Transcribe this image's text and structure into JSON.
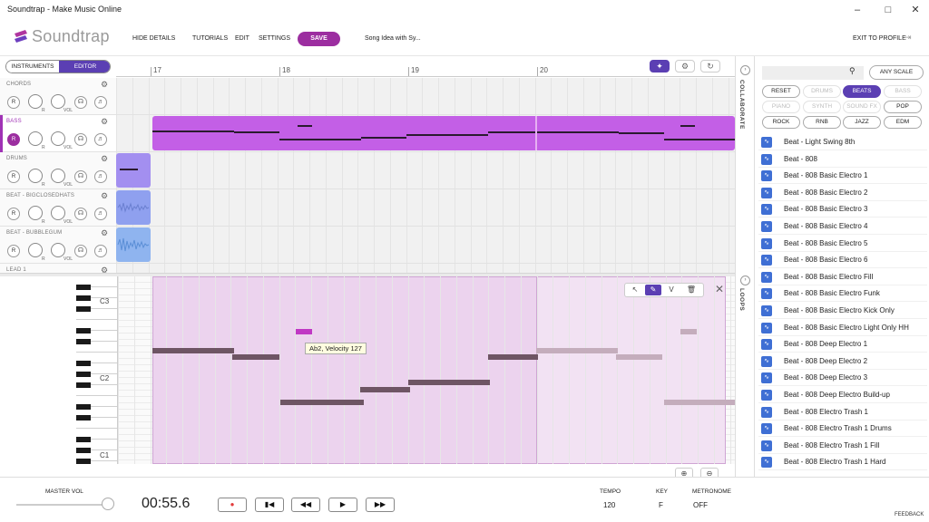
{
  "window": {
    "title": "Soundtrap - Make Music Online"
  },
  "header": {
    "logo_text": "Soundtrap",
    "menu": [
      "HIDE DETAILS",
      "TUTORIALS",
      "EDIT",
      "SETTINGS"
    ],
    "save_label": "SAVE",
    "song_title": "Song Idea with Sy...",
    "exit_label": "EXIT TO PROFILE"
  },
  "toolbar": {
    "view_toggle": [
      "INSTRUMENTS",
      "EDITOR"
    ],
    "selected_view": "EDITOR",
    "ruler_labels": [
      "17",
      "18",
      "19",
      "20"
    ]
  },
  "tracks": [
    {
      "name": "CHORDS",
      "active": false,
      "record_label": "R"
    },
    {
      "name": "BASS",
      "active": true,
      "record_label": "R"
    },
    {
      "name": "DRUMS",
      "active": false,
      "record_label": "R"
    },
    {
      "name": "BEAT - BIGCLOSEDHATS",
      "active": false,
      "record_label": "R"
    },
    {
      "name": "BEAT - BUBBLEGUM",
      "active": false,
      "record_label": "R"
    },
    {
      "name": "LEAD 1",
      "active": false,
      "record_label": "R"
    }
  ],
  "knob_labels": {
    "vol": "VOL",
    "pan": "R"
  },
  "piano_roll": {
    "octave_labels": [
      "C3",
      "C2",
      "C1"
    ],
    "tooltip": "Ab2, Velocity 127",
    "tools": [
      "select",
      "pencil",
      "V",
      "delete"
    ]
  },
  "side_tabs": {
    "collaborate": "COLLABORATE",
    "loops": "LOOPS"
  },
  "loops": {
    "search_placeholder": "",
    "scale_button": "ANY SCALE",
    "filters": [
      {
        "label": "RESET",
        "state": "normal"
      },
      {
        "label": "DRUMS",
        "state": "disabled"
      },
      {
        "label": "BEATS",
        "state": "active"
      },
      {
        "label": "BASS",
        "state": "disabled"
      },
      {
        "label": "PIANO",
        "state": "disabled"
      },
      {
        "label": "SYNTH",
        "state": "disabled"
      },
      {
        "label": "SOUND FX",
        "state": "disabled"
      },
      {
        "label": "POP",
        "state": "normal"
      },
      {
        "label": "ROCK",
        "state": "normal"
      },
      {
        "label": "RNB",
        "state": "normal"
      },
      {
        "label": "JAZZ",
        "state": "normal"
      },
      {
        "label": "EDM",
        "state": "normal"
      }
    ],
    "items": [
      "Beat - Light Swing 8th",
      "Beat - 808",
      "Beat - 808 Basic Electro 1",
      "Beat - 808 Basic Electro 2",
      "Beat - 808 Basic Electro 3",
      "Beat - 808 Basic Electro 4",
      "Beat - 808 Basic Electro 5",
      "Beat - 808 Basic Electro 6",
      "Beat - 808 Basic Electro Fill",
      "Beat - 808 Basic Electro Funk",
      "Beat - 808 Basic Electro Kick Only",
      "Beat - 808 Basic Electro Light Only HH",
      "Beat - 808 Deep Electro 1",
      "Beat - 808 Deep Electro 2",
      "Beat - 808 Deep Electro 3",
      "Beat - 808 Deep Electro Build-up",
      "Beat - 808 Electro Trash 1",
      "Beat - 808 Electro Trash 1 Drums",
      "Beat - 808 Electro Trash 1 Fill",
      "Beat - 808 Electro Trash 1 Hard"
    ]
  },
  "transport": {
    "master_vol_label": "MASTER VOL",
    "time": "00:55.6",
    "tempo_label": "TEMPO",
    "tempo": "120",
    "key_label": "KEY",
    "key": "F",
    "metronome_label": "METRONOME",
    "metronome": "OFF",
    "feedback": "FEEDBACK"
  },
  "colors": {
    "accent_purple": "#9c2ea0",
    "editor_violet": "#5b3fb3",
    "bass_clip": "#c35fe6",
    "drum_clip": "#a38ff0",
    "beat_clip": "#8fb4ef",
    "loop_icon": "#3f6fd4"
  }
}
